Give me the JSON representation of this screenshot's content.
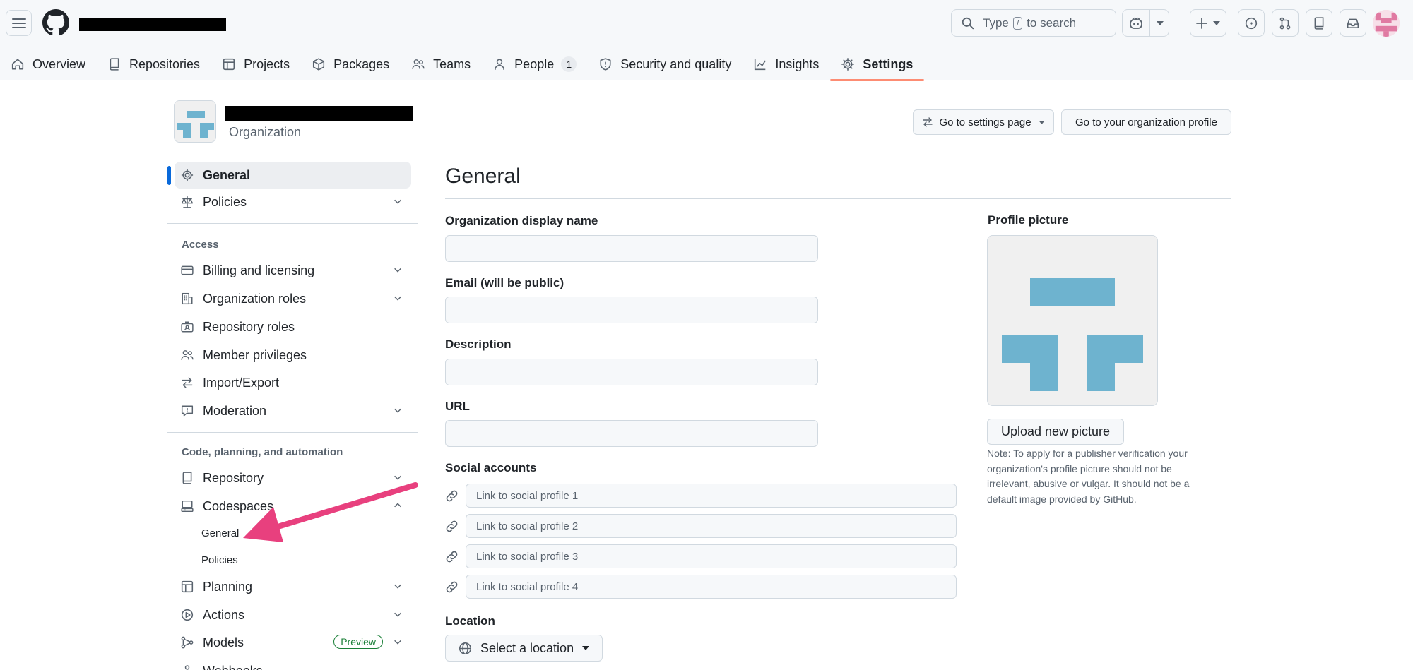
{
  "header": {
    "search_prefix": "Type",
    "search_key": "/",
    "search_suffix": "to search"
  },
  "tabs": [
    {
      "label": "Overview",
      "icon": "home-icon"
    },
    {
      "label": "Repositories",
      "icon": "repo-icon"
    },
    {
      "label": "Projects",
      "icon": "table-icon"
    },
    {
      "label": "Packages",
      "icon": "package-icon"
    },
    {
      "label": "Teams",
      "icon": "people-icon"
    },
    {
      "label": "People",
      "icon": "person-icon",
      "count": "1"
    },
    {
      "label": "Security and quality",
      "icon": "shield-icon"
    },
    {
      "label": "Insights",
      "icon": "graph-icon"
    },
    {
      "label": "Settings",
      "icon": "gear-icon",
      "active": true
    }
  ],
  "org": {
    "type_label": "Organization",
    "goto_settings_label": "Go to settings page",
    "goto_profile_label": "Go to your organization profile"
  },
  "sidebar": {
    "general": "General",
    "policies": "Policies",
    "access_heading": "Access",
    "billing": "Billing and licensing",
    "org_roles": "Organization roles",
    "repo_roles": "Repository roles",
    "member_privileges": "Member privileges",
    "import_export": "Import/Export",
    "moderation": "Moderation",
    "code_heading": "Code, planning, and automation",
    "repository": "Repository",
    "codespaces": "Codespaces",
    "codespaces_general": "General",
    "codespaces_policies": "Policies",
    "planning": "Planning",
    "actions": "Actions",
    "models": "Models",
    "models_badge": "Preview",
    "webhooks_partial": "Webhooks"
  },
  "main": {
    "title": "General",
    "display_name_label": "Organization display name",
    "display_name_value": "",
    "email_label": "Email (will be public)",
    "email_value": "",
    "description_label": "Description",
    "description_value": "",
    "url_label": "URL",
    "url_value": "",
    "social_label": "Social accounts",
    "social_placeholders": [
      "Link to social profile 1",
      "Link to social profile 2",
      "Link to social profile 3",
      "Link to social profile 4"
    ],
    "location_label": "Location",
    "location_button": "Select a location"
  },
  "profile_picture": {
    "label": "Profile picture",
    "upload_label": "Upload new picture",
    "note": "Note: To apply for a publisher verification your organization's profile picture should not be irrelevant, abusive or vulgar. It should not be a default image provided by GitHub."
  },
  "colors": {
    "accent_blue": "#0969da",
    "active_tab_underline": "#fd8c73",
    "identicon": "#6eb3cf",
    "annotation_arrow": "#e8407e",
    "preview_green": "#1a7f37"
  }
}
